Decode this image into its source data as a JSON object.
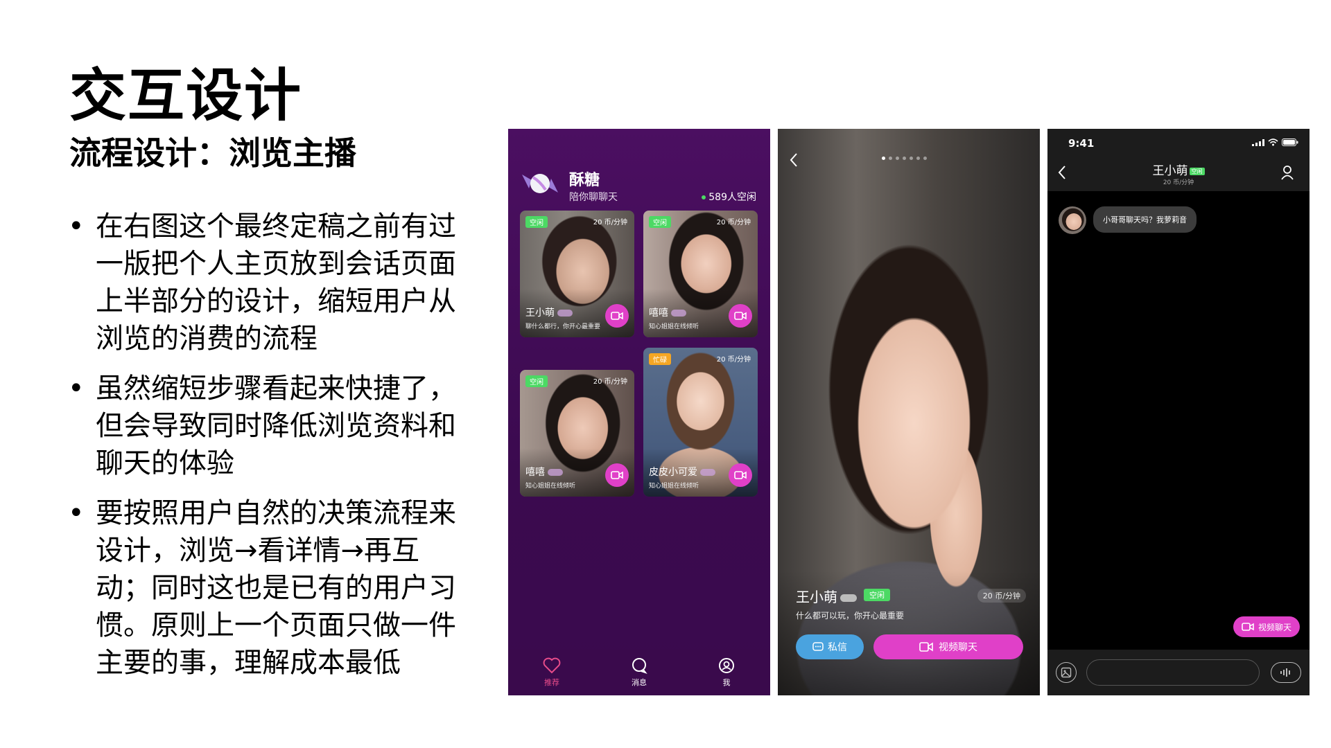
{
  "slide": {
    "title": "交互设计",
    "subtitle": "流程设计：浏览主播",
    "bullets": [
      "在右图这个最终定稿之前有过一版把个人主页放到会话页面上半部分的设计，缩短用户从浏览的消费的流程",
      "虽然缩短步骤看起来快捷了，但会导致同时降低浏览资料和聊天的体验",
      "要按照用户自然的决策流程来设计，浏览→看详情→再互动；同时这也是已有的用户习惯。原则上一个页面只做一件主要的事，理解成本最低"
    ]
  },
  "screen_list": {
    "app_title": "酥糖",
    "app_subtitle": "陪你聊聊天",
    "online_count": "589人空闲",
    "cards": [
      {
        "tag": "空闲",
        "price": "20 币/分钟",
        "name": "王小萌",
        "desc": "聊什么都行，你开心最重要"
      },
      {
        "tag": "空闲",
        "price": "20 币/分钟",
        "name": "嘻嘻",
        "desc": "知心姐姐在线倾听"
      },
      {
        "tag": "空闲",
        "price": "20 币/分钟",
        "name": "嘻嘻",
        "desc": "知心姐姐在线倾听"
      },
      {
        "tag": "忙碌",
        "price": "20 币/分钟",
        "name": "皮皮小可爱",
        "desc": "知心姐姐在线倾听"
      }
    ],
    "tabs": [
      "推荐",
      "消息",
      "我"
    ],
    "colors": {
      "background": "#4b0f61",
      "accent": "#e040c8",
      "free": "#4cd964"
    }
  },
  "screen_profile": {
    "name": "王小萌",
    "tag": "空闲",
    "price": "20 币/分钟",
    "desc": "什么都可以玩，你开心最重要",
    "message_btn": "私信",
    "video_btn": "视频聊天"
  },
  "screen_chat": {
    "time": "9:41",
    "title": "王小萌",
    "tag": "空闲",
    "price": "20 币/分钟",
    "message": "小哥哥聊天吗？我萝莉音",
    "video_btn": "视频聊天",
    "input_placeholder": ""
  }
}
